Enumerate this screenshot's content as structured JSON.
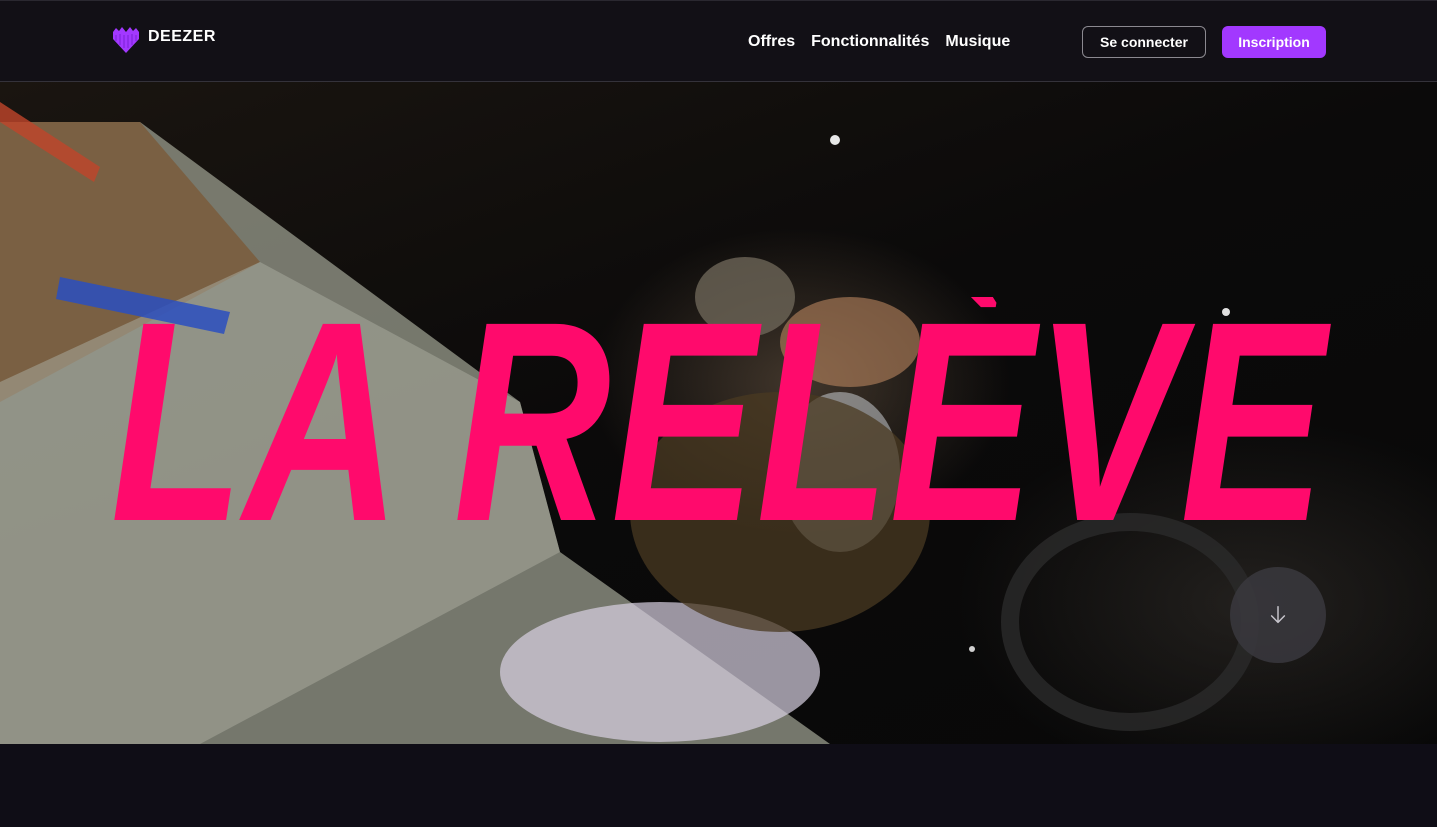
{
  "header": {
    "logo_text": "DEEZER",
    "logo_icon": "deezer-heart-icon",
    "nav": [
      {
        "label": "Offres"
      },
      {
        "label": "Fonctionnalités"
      },
      {
        "label": "Musique"
      }
    ],
    "login_label": "Se connecter",
    "signup_label": "Inscription"
  },
  "hero": {
    "title": "LA RELÈVE",
    "scroll_icon": "arrow-down-icon"
  },
  "colors": {
    "brand_purple": "#a238ff",
    "title_pink": "#ff0a6c",
    "background": "#121016"
  }
}
